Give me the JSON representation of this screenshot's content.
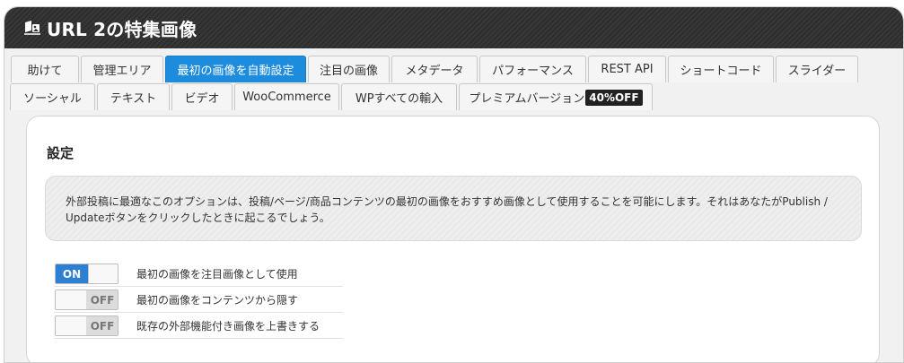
{
  "title": "URL 2の特集画像",
  "tabs_row1": [
    {
      "label": "助けて"
    },
    {
      "label": "管理エリア"
    },
    {
      "label": "最初の画像を自動設定",
      "active": true
    },
    {
      "label": "注目の画像"
    },
    {
      "label": "メタデータ"
    },
    {
      "label": "パフォーマンス"
    },
    {
      "label": "REST API"
    },
    {
      "label": "ショートコード"
    },
    {
      "label": "スライダー"
    }
  ],
  "tabs_row2": [
    {
      "label": "ソーシャル"
    },
    {
      "label": "テキスト"
    },
    {
      "label": "ビデオ"
    },
    {
      "label": "WooCommerce"
    },
    {
      "label": "WPすべての輸入"
    },
    {
      "label": "プレミアムバージョン",
      "badge": "40%OFF"
    }
  ],
  "panel": {
    "title": "設定",
    "notice": "外部投稿に最適なこのオプションは、投稿/ページ/商品コンテンツの最初の画像をおすすめ画像として使用することを可能にします。それはあなたがPublish / Updateボタンをクリックしたときに起こるでしょう。",
    "options": [
      {
        "state": "ON",
        "label": "最初の画像を注目画像として使用"
      },
      {
        "state": "OFF",
        "label": "最初の画像をコンテンツから隠す"
      },
      {
        "state": "OFF",
        "label": "既存の外部機能付き画像を上書きする"
      }
    ]
  },
  "colors": {
    "accent": "#1e8cdd",
    "title_bar": "#2d2d2d",
    "toggle_on": "#2d7fd3"
  },
  "icons": {
    "title": "plugin-logo-icon"
  }
}
